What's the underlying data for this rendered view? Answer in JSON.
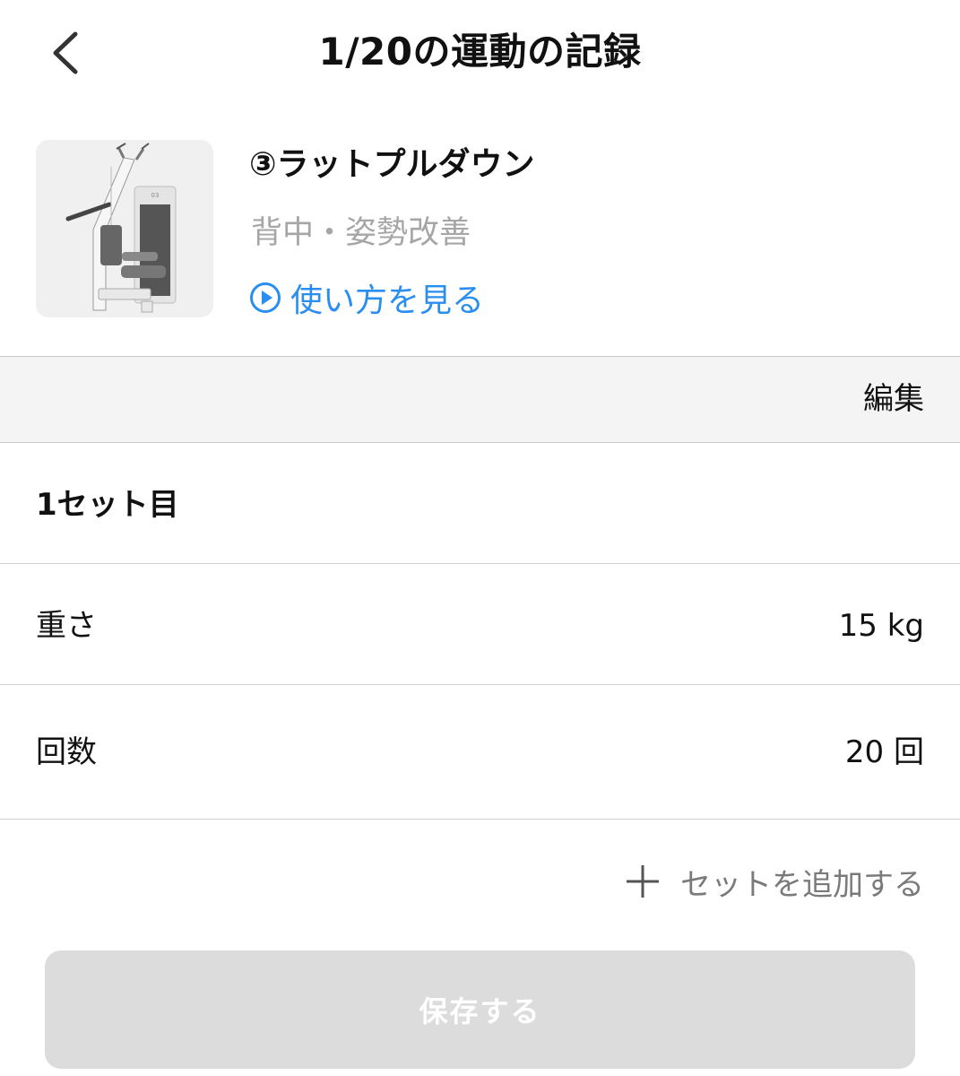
{
  "header": {
    "title": "1/20の運動の記録",
    "back_icon": "chevron-left-icon"
  },
  "exercise": {
    "name": "③ラットプルダウン",
    "tags": "背中・姿勢改善",
    "howto_label": "使い方を見る",
    "howto_icon": "play-circle-icon",
    "machine_image": "lat-pulldown-machine",
    "machine_number": "03"
  },
  "edit_label": "編集",
  "set": {
    "title": "1セット目",
    "weight_label": "重さ",
    "weight_value": "15 kg",
    "reps_label": "回数",
    "reps_value": "20 回"
  },
  "add_set_label": "セットを追加する",
  "save_label": "保存する",
  "colors": {
    "link": "#2a8ef0",
    "muted": "#a6a6a6",
    "disabled_button": "#dcdcdc",
    "section_bg": "#f4f4f4"
  }
}
